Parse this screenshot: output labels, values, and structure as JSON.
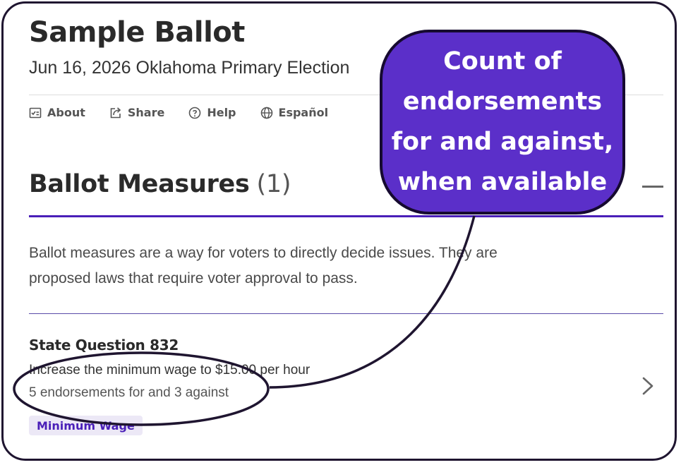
{
  "page": {
    "title": "Sample Ballot",
    "subtitle": "Jun 16, 2026 Oklahoma Primary Election"
  },
  "nav": {
    "items": [
      {
        "label": "About",
        "icon": "checklist-icon"
      },
      {
        "label": "Share",
        "icon": "share-icon"
      },
      {
        "label": "Help",
        "icon": "help-icon"
      },
      {
        "label": "Español",
        "icon": "globe-icon"
      }
    ]
  },
  "section": {
    "title": "Ballot Measures",
    "count": "(1)",
    "description": "Ballot measures are a way for voters to directly decide issues. They are proposed laws that require voter approval to pass."
  },
  "measures": [
    {
      "title": "State Question 832",
      "description": "Increase the minimum wage to $15.00 per hour",
      "endorsements": "5 endorsements for and 3 against",
      "tag": "Minimum Wage"
    }
  ],
  "annotation": {
    "callout_text": "Count of\nendorsements\nfor and against,\nwhen available"
  },
  "colors": {
    "accent": "#4a1fb8",
    "callout_fill": "#5b2fc9",
    "tag_bg": "#ece8f6",
    "annotation_stroke": "#1f1530"
  }
}
